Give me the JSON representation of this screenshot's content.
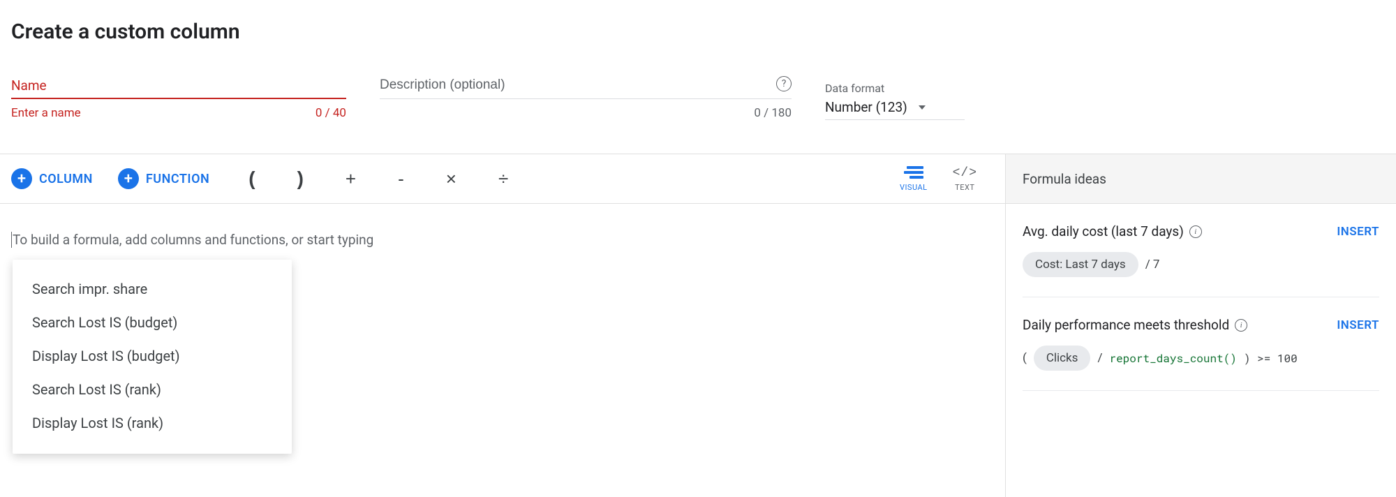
{
  "page_title": "Create a custom column",
  "name_field": {
    "label": "Name",
    "helper": "Enter a name",
    "counter": "0 / 40"
  },
  "desc_field": {
    "placeholder": "Description (optional)",
    "counter": "0 / 180"
  },
  "data_format": {
    "label": "Data format",
    "value": "Number (123)"
  },
  "toolbar": {
    "column_label": "COLUMN",
    "function_label": "FUNCTION",
    "ops": {
      "lparen": "(",
      "rparen": ")",
      "plus": "+",
      "minus": "-",
      "times": "×",
      "divide": "÷"
    },
    "mode_visual": "VISUAL",
    "mode_text": "TEXT",
    "text_icon": "</>"
  },
  "formula_placeholder": "To build a formula, add columns and functions, or start typing",
  "suggestions": [
    "Search impr. share",
    "Search Lost IS (budget)",
    "Display Lost IS (budget)",
    "Search Lost IS (rank)",
    "Display Lost IS (rank)"
  ],
  "sidebar_title": "Formula ideas",
  "insert_label": "INSERT",
  "ideas": [
    {
      "title": "Avg. daily cost (last 7 days)",
      "chip": "Cost: Last 7 days",
      "suffix": "/ 7"
    },
    {
      "title": "Daily performance meets threshold",
      "prefix": "(",
      "chip": "Clicks",
      "mid": "/ ",
      "code": "report_days_count()",
      "tail": ") >= 100"
    }
  ]
}
